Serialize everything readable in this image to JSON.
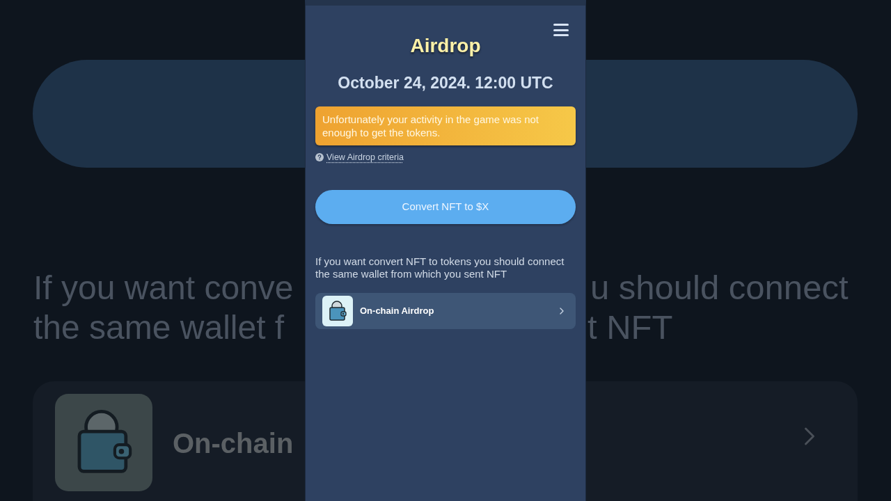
{
  "backdrop": {
    "left_lines": [
      "If you want conve",
      "the same wallet f"
    ],
    "right_lines": [
      "u should connect",
      "t NFT"
    ],
    "card_label": "On-chain"
  },
  "screen": {
    "title": "Airdrop",
    "date": "October 24, 2024. 12:00 UTC",
    "alert": "Unfortunately your activity in the game was not enough to get the tokens.",
    "criteria_link": "View Airdrop criteria",
    "primary_button": "Convert NFT to $X",
    "hint": "If you want convert NFT to tokens you should connect the same wallet from which you sent NFT",
    "items": [
      {
        "label": "On-chain Airdrop"
      }
    ]
  }
}
